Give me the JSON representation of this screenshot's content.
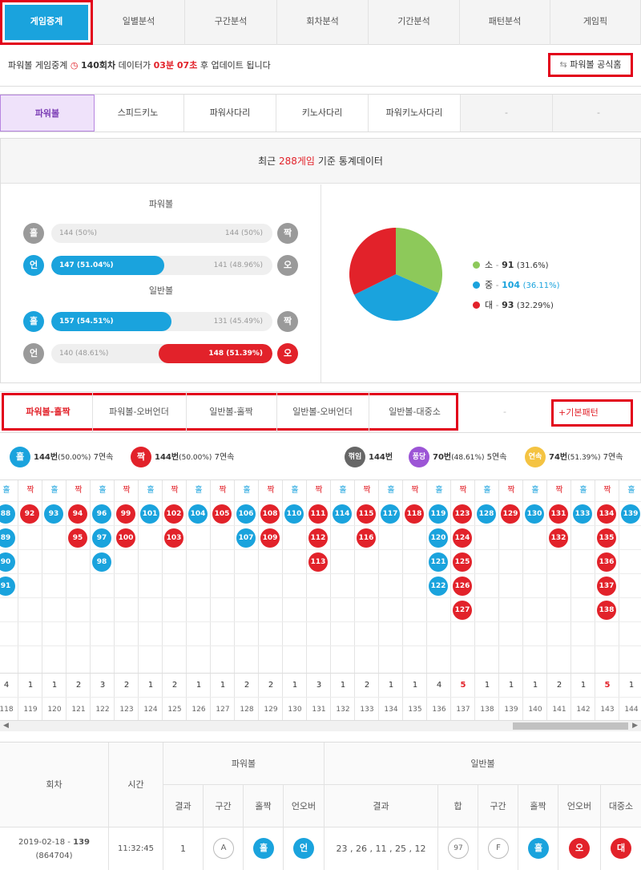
{
  "topnav": [
    "게임중계",
    "일별분석",
    "구간분석",
    "회차분석",
    "기간분석",
    "패턴분석",
    "게임픽"
  ],
  "info": {
    "prefix": "파워볼 게임중계",
    "round": "140회차",
    "mid": "데이터가",
    "time": "03분 07초",
    "suffix": "후 업데이트 됩니다",
    "home_label": "파워볼 공식홈"
  },
  "gametabs": [
    "파워볼",
    "스피드키노",
    "파워사다리",
    "키노사다리",
    "파워키노사다리",
    "-",
    "-"
  ],
  "stats": {
    "head_prefix": "최근",
    "head_count": "288게임",
    "head_suffix": "기준 통계데이터",
    "powerball_title": "파워볼",
    "normal_title": "일반볼",
    "rows": [
      {
        "left_icon": "홀",
        "right_icon": "짝",
        "left_text": "144 (50%)",
        "right_text": "144 (50%)",
        "winner": "none",
        "fraction": 0.5
      },
      {
        "left_icon": "언",
        "right_icon": "오",
        "left_text": "147 (51.04%)",
        "right_text": "141 (48.96%)",
        "winner": "left",
        "fraction": 0.5104
      },
      {
        "left_icon": "홀",
        "right_icon": "짝",
        "left_text": "157 (54.51%)",
        "right_text": "131 (45.49%)",
        "winner": "left",
        "fraction": 0.5451
      },
      {
        "left_icon": "언",
        "right_icon": "오",
        "left_text": "140 (48.61%)",
        "right_text": "148 (51.39%)",
        "winner": "right",
        "fraction": 0.5139
      }
    ],
    "legend": [
      {
        "label": "소",
        "value": "91",
        "pct": "(31.6%)",
        "color": "#8dc95a"
      },
      {
        "label": "중",
        "value": "104",
        "pct": "(36.11%)",
        "color": "#1aa3dd"
      },
      {
        "label": "대",
        "value": "93",
        "pct": "(32.29%)",
        "color": "#e2222a"
      }
    ]
  },
  "chart_data": {
    "type": "pie",
    "categories": [
      "소",
      "중",
      "대"
    ],
    "values": [
      91,
      104,
      93
    ]
  },
  "pattabs": [
    "파워볼-홀짝",
    "파워볼-오버언더",
    "일반볼-홀짝",
    "일반볼-오버언더",
    "일반볼-대중소",
    "-"
  ],
  "basic_pattern": "+기본패턴",
  "patlegend": {
    "odd_icon": "홀",
    "odd_text": "144번",
    "odd_pct": "(50.00%)",
    "odd_streak": "7연속",
    "even_icon": "짝",
    "even_text": "144번",
    "even_pct": "(50.00%)",
    "even_streak": "7연속",
    "broken_icon": "꺾임",
    "broken_text": "144번",
    "pong_icon": "퐁당",
    "pong_text": "70번",
    "pong_pct": "(48.61%)",
    "pong_streak": "5연속",
    "cont_icon": "연속",
    "cont_text": "74번",
    "cont_pct": "(51.39%)",
    "cont_streak": "7연속"
  },
  "grid": {
    "odd_label": "홀",
    "even_label": "짝",
    "columns": [
      {
        "t": "o",
        "balls": [
          "88",
          "89",
          "90",
          "91"
        ],
        "count": "4",
        "round": "118"
      },
      {
        "t": "e",
        "balls": [
          "92"
        ],
        "count": "1",
        "round": "119"
      },
      {
        "t": "o",
        "balls": [
          "93"
        ],
        "count": "1",
        "round": "120"
      },
      {
        "t": "e",
        "balls": [
          "94",
          "95"
        ],
        "count": "2",
        "round": "121"
      },
      {
        "t": "o",
        "balls": [
          "96",
          "97",
          "98"
        ],
        "count": "3",
        "round": "122"
      },
      {
        "t": "e",
        "balls": [
          "99",
          "100"
        ],
        "count": "2",
        "round": "123"
      },
      {
        "t": "o",
        "balls": [
          "101"
        ],
        "count": "1",
        "round": "124"
      },
      {
        "t": "e",
        "balls": [
          "102",
          "103"
        ],
        "count": "2",
        "round": "125"
      },
      {
        "t": "o",
        "balls": [
          "104"
        ],
        "count": "1",
        "round": "126"
      },
      {
        "t": "e",
        "balls": [
          "105"
        ],
        "count": "1",
        "round": "127"
      },
      {
        "t": "o",
        "balls": [
          "106",
          "107"
        ],
        "count": "2",
        "round": "128"
      },
      {
        "t": "e",
        "balls": [
          "108",
          "109"
        ],
        "count": "2",
        "round": "129"
      },
      {
        "t": "o",
        "balls": [
          "110"
        ],
        "count": "1",
        "round": "130"
      },
      {
        "t": "e",
        "balls": [
          "111",
          "112",
          "113"
        ],
        "count": "3",
        "round": "131"
      },
      {
        "t": "o",
        "balls": [
          "114"
        ],
        "count": "1",
        "round": "132"
      },
      {
        "t": "e",
        "balls": [
          "115",
          "116"
        ],
        "count": "2",
        "round": "133"
      },
      {
        "t": "o",
        "balls": [
          "117"
        ],
        "count": "1",
        "round": "134"
      },
      {
        "t": "e",
        "balls": [
          "118"
        ],
        "count": "1",
        "round": "135"
      },
      {
        "t": "o",
        "balls": [
          "119",
          "120",
          "121",
          "122"
        ],
        "count": "4",
        "round": "136"
      },
      {
        "t": "e",
        "balls": [
          "123",
          "124",
          "125",
          "126",
          "127"
        ],
        "count": "5",
        "round": "137"
      },
      {
        "t": "o",
        "balls": [
          "128"
        ],
        "count": "1",
        "round": "138"
      },
      {
        "t": "e",
        "balls": [
          "129"
        ],
        "count": "1",
        "round": "139"
      },
      {
        "t": "o",
        "balls": [
          "130"
        ],
        "count": "1",
        "round": "140"
      },
      {
        "t": "e",
        "balls": [
          "131",
          "132"
        ],
        "count": "2",
        "round": "141"
      },
      {
        "t": "o",
        "balls": [
          "133"
        ],
        "count": "1",
        "round": "142"
      },
      {
        "t": "e",
        "balls": [
          "134",
          "135",
          "136",
          "137",
          "138"
        ],
        "count": "5",
        "round": "143"
      },
      {
        "t": "o",
        "balls": [
          "139"
        ],
        "count": "1",
        "round": "144"
      }
    ]
  },
  "table": {
    "h_round": "회차",
    "h_time": "시간",
    "h_power": "파워볼",
    "h_normal": "일반볼",
    "h_result": "결과",
    "h_section": "구간",
    "h_oddeven": "홀짝",
    "h_overunder": "언오버",
    "h_nresult": "결과",
    "h_sum": "합",
    "h_nsection": "구간",
    "h_noddeven": "홀짝",
    "h_nou": "언오버",
    "h_size": "대중소",
    "row": {
      "date": "2019-02-18 -",
      "round": "139",
      "id": "(864704)",
      "time": "11:32:45",
      "p_result": "1",
      "p_section": "A",
      "p_oddeven": "홀",
      "p_ou": "언",
      "n_result": "23 , 26 , 11 , 25 , 12",
      "n_sum": "97",
      "n_section": "F",
      "n_oddeven": "홀",
      "n_ou": "오",
      "n_size": "대"
    }
  }
}
